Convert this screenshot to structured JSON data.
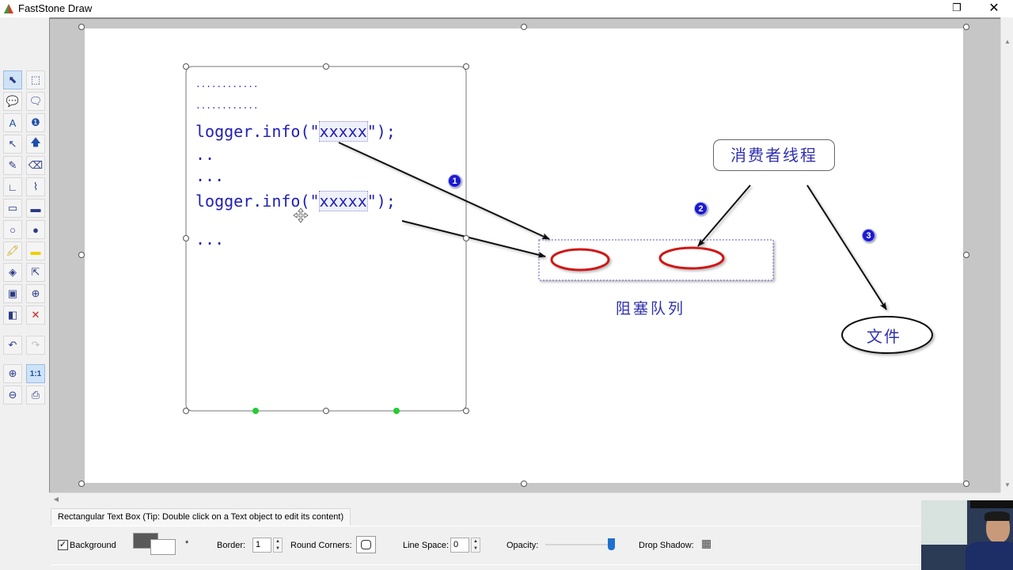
{
  "window": {
    "title": "FastStone Draw",
    "restore_icon": "❐",
    "close_icon": "✕"
  },
  "toolbar": {
    "tools": [
      {
        "name": "select-tool",
        "glyph": "⬉",
        "active": true
      },
      {
        "name": "marquee-select-tool",
        "glyph": "⬚"
      },
      {
        "name": "rect-callout-tool",
        "glyph": "💬"
      },
      {
        "name": "round-callout-tool",
        "glyph": "🗨"
      },
      {
        "name": "text-tool",
        "glyph": "A"
      },
      {
        "name": "step-number-tool",
        "glyph": "❶"
      },
      {
        "name": "arrow-tool",
        "glyph": "↖"
      },
      {
        "name": "block-arrow-tool",
        "glyph": "🡅"
      },
      {
        "name": "pen-tool",
        "glyph": "✎"
      },
      {
        "name": "eraser-tool",
        "glyph": "⌫"
      },
      {
        "name": "line-tool",
        "glyph": "∟"
      },
      {
        "name": "curve-tool",
        "glyph": "⌇"
      },
      {
        "name": "rectangle-tool",
        "glyph": "▭"
      },
      {
        "name": "filled-rectangle-tool",
        "glyph": "▬"
      },
      {
        "name": "ellipse-tool",
        "glyph": "○"
      },
      {
        "name": "filled-ellipse-tool",
        "glyph": "●"
      },
      {
        "name": "highlighter-tool",
        "glyph": "🖍"
      },
      {
        "name": "highlight-rect-tool",
        "glyph": "▬"
      },
      {
        "name": "fill-tool",
        "glyph": "◈"
      },
      {
        "name": "add-pointer-tool",
        "glyph": "⇱"
      },
      {
        "name": "image-tool",
        "glyph": "▣"
      },
      {
        "name": "magnify-tool",
        "glyph": "⊕"
      },
      {
        "name": "background-color-tool",
        "glyph": "◧"
      },
      {
        "name": "delete-tool",
        "glyph": "✕"
      },
      {
        "name": "undo-button",
        "glyph": "↶"
      },
      {
        "name": "redo-button",
        "glyph": "↷"
      },
      {
        "name": "zoom-in-button",
        "glyph": "⊕"
      },
      {
        "name": "actual-size-button",
        "glyph": "1:1",
        "active": true
      },
      {
        "name": "zoom-out-button",
        "glyph": "⊖"
      },
      {
        "name": "print-button",
        "glyph": "⎙"
      }
    ]
  },
  "canvas": {
    "code_block": {
      "dots1": "............",
      "dots2": "............",
      "line1_prefix": "logger.info(\"",
      "line1_arg": "xxxxx",
      "line1_suffix": "\");",
      "line2": "..",
      "line3": "...",
      "line4_prefix": "logger.info(\"",
      "line4_arg": "xxxxx",
      "line4_suffix": "\");",
      "line5": "..."
    },
    "badges": {
      "b1": "1",
      "b2": "2",
      "b3": "3"
    },
    "consumer_thread_label": "消费者线程",
    "blocking_queue_label": "阻塞队列",
    "file_label": "文件"
  },
  "status": {
    "tab_label": "Rectangular Text Box (Tip: Double click on a Text object to edit its content)"
  },
  "properties": {
    "background_label": "Background",
    "background_checked": true,
    "fore_color": "#595959",
    "back_color": "#ffffff",
    "asterisk": "*",
    "border_label": "Border:",
    "border_value": "1",
    "round_corners_label": "Round Corners:",
    "line_space_label": "Line Space:",
    "line_space_value": "0",
    "opacity_label": "Opacity:",
    "opacity_percent": 100,
    "drop_shadow_label": "Drop Shadow:"
  },
  "colors": {
    "text_blue": "#2020b8",
    "badge_blue": "#1a1ad0",
    "queue_item_red": "#d01818",
    "handle_green": "#22cc33"
  }
}
